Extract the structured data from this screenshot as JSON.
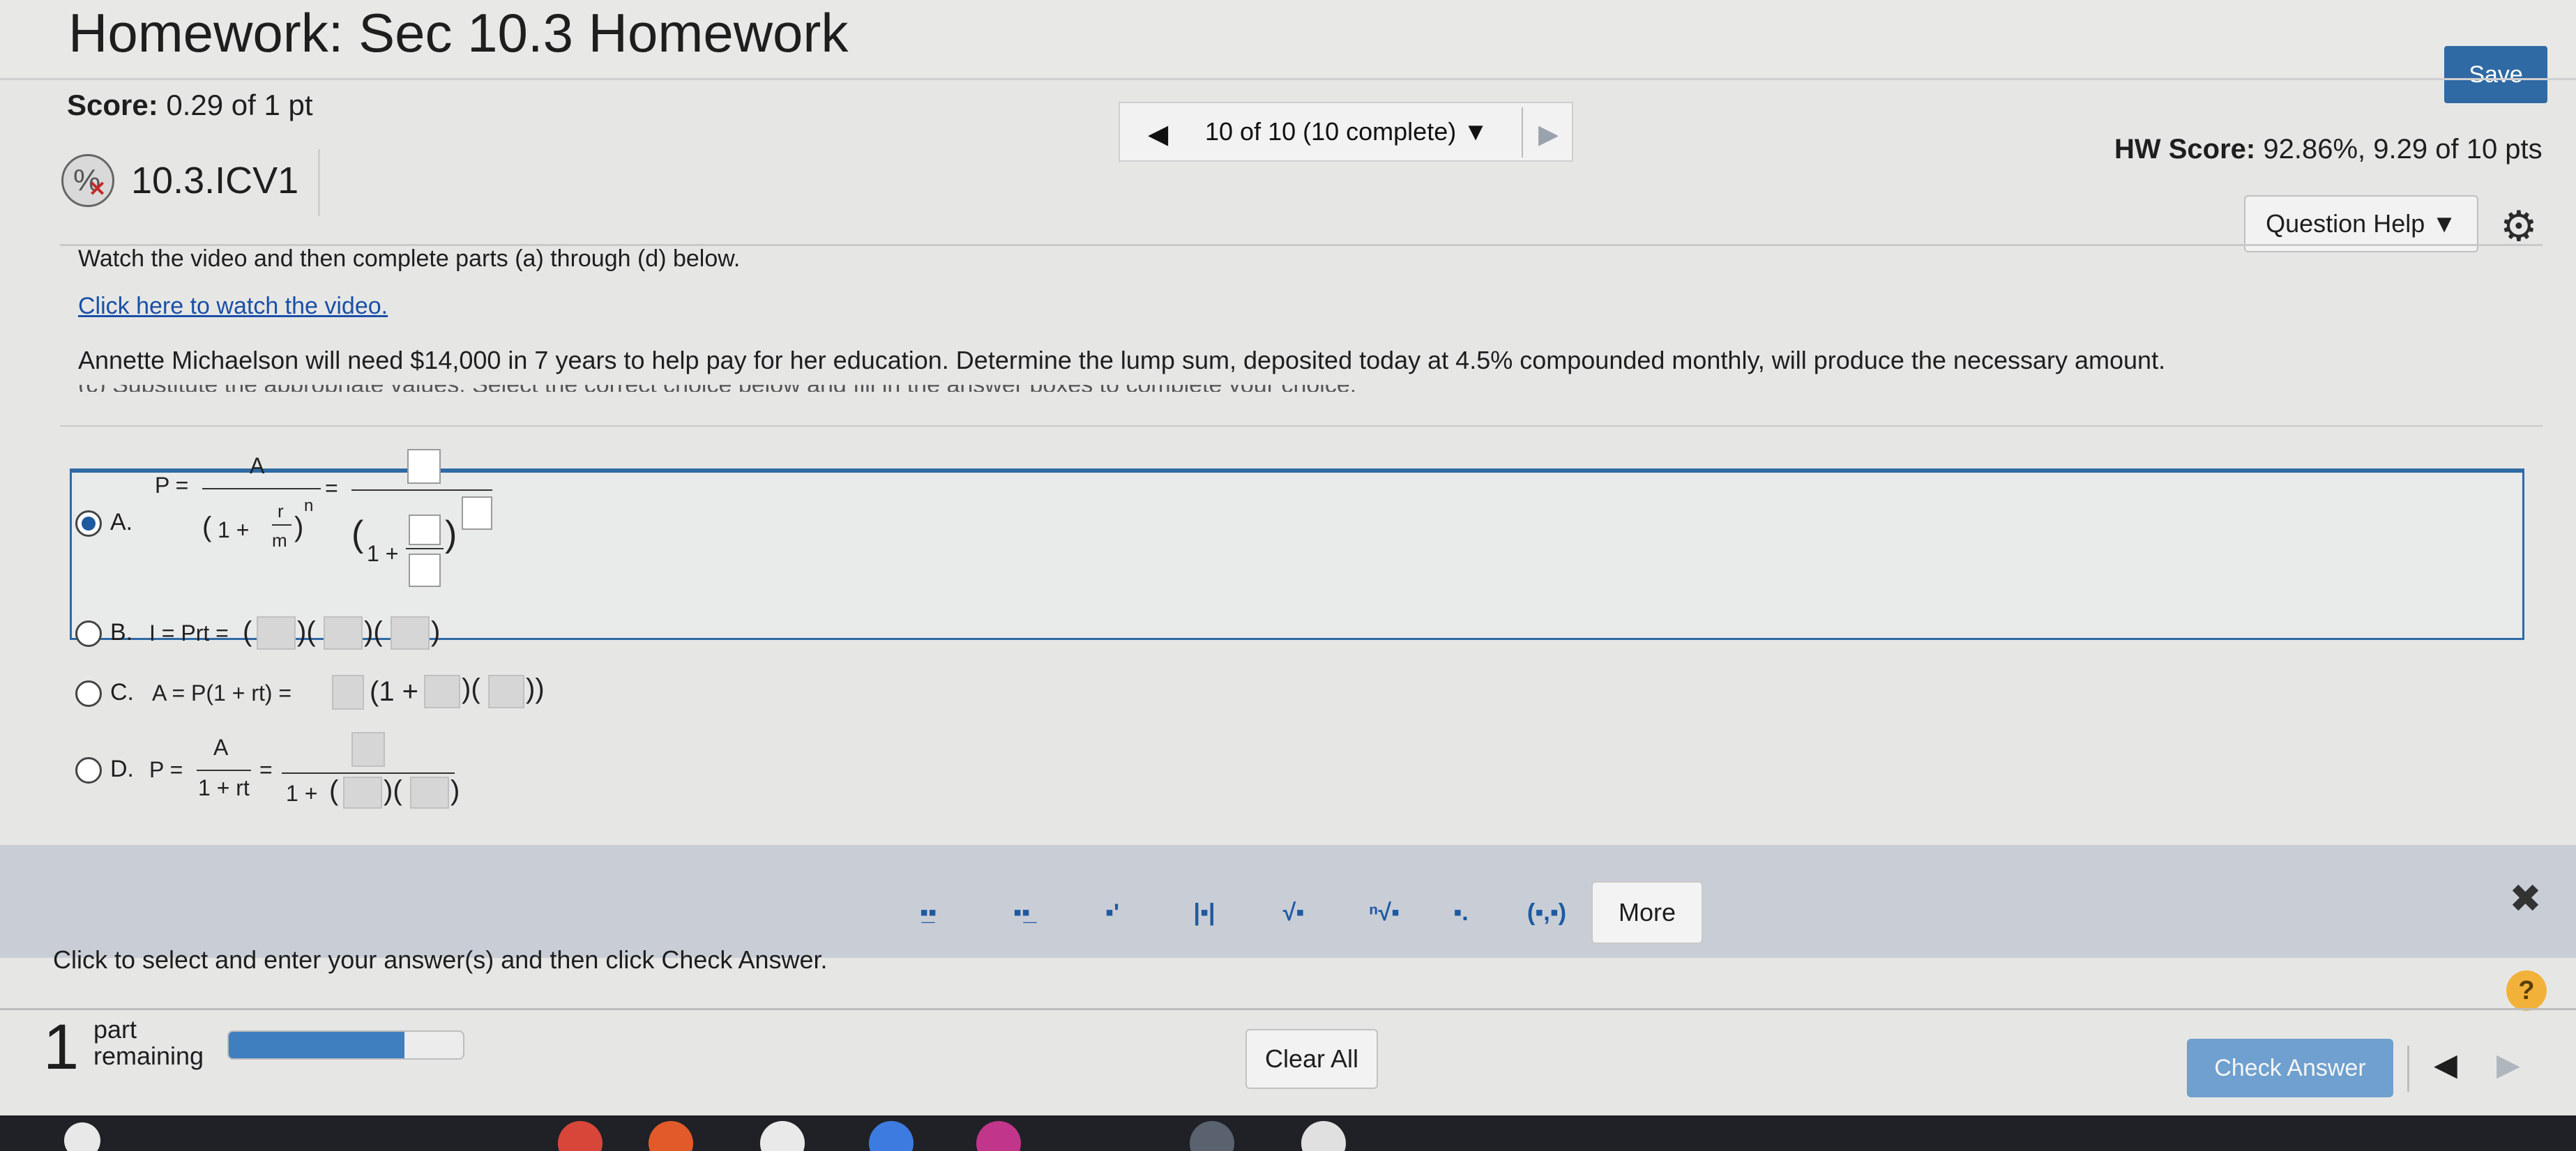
{
  "header": {
    "title": "Homework: Sec 10.3 Homework",
    "save_label": "Save"
  },
  "score_bar": {
    "score_label": "Score:",
    "score_value": "0.29 of 1 pt",
    "nav_label": "10 of 10 (10 complete)",
    "nav_dropdown_icon": "▼",
    "nav_prev_icon": "◀",
    "nav_next_icon": "▶",
    "hw_score_label": "HW Score:",
    "hw_score_value": "92.86%, 9.29 of 10 pts"
  },
  "question": {
    "id": "10.3.ICV1",
    "help_label": "Question Help ▼",
    "instructions": "Watch the video and then complete parts (a) through (d) below.",
    "video_link": "Click here to watch the video.",
    "problem": "Annette Michaelson will need $14,000 in 7 years to help pay for her education. Determine the lump sum, deposited today at 4.5% compounded monthly, will produce the necessary amount.",
    "cut_text": "(c) Substitute the appropriate values. Select the correct choice below and fill in the answer boxes to complete your choice."
  },
  "choices": [
    {
      "letter": "A.",
      "selected": true,
      "p_eq": "P =",
      "numerator": "A",
      "den_prefix": "1 +",
      "r": "r",
      "m": "m",
      "n": "n",
      "eq": "=",
      "box_den_prefix": "1 +"
    },
    {
      "letter": "B.",
      "selected": false,
      "formula": "I = Prt ="
    },
    {
      "letter": "C.",
      "selected": false,
      "formula": "A = P(1 + rt) =",
      "inner": "(1 +"
    },
    {
      "letter": "D.",
      "selected": false,
      "p_eq": "P =",
      "numerator": "A",
      "denominator": "1 + rt",
      "eq": "=",
      "box_den_prefix": "1 +"
    }
  ],
  "toolbar": {
    "tools": [
      "fraction-icon",
      "mixed-number-icon",
      "exponent-icon",
      "absolute-value-icon",
      "square-root-icon",
      "nth-root-icon",
      "subscript-icon",
      "ordered-pair-icon"
    ],
    "tool_glyphs": [
      "▪̲▪",
      "▪▪̲",
      "▪'",
      "|▪|",
      "√▪",
      "ⁿ√▪",
      "▪.",
      "(▪,▪)"
    ],
    "more_label": "More",
    "close_icon": "✖"
  },
  "footer": {
    "hint": "Click to select and enter your answer(s) and then click Check Answer.",
    "help_icon": "?",
    "parts_count": "1",
    "parts_line1": "part",
    "parts_line2": "remaining",
    "progress": 0.75,
    "clear_label": "Clear All",
    "check_label": "Check Answer",
    "prev_icon": "◀",
    "next_icon": "▶"
  }
}
